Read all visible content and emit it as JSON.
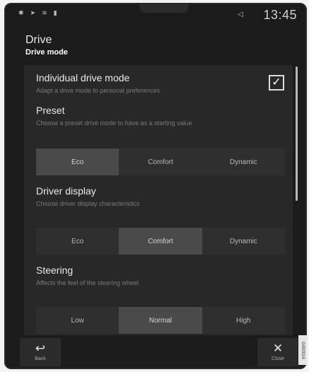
{
  "status": {
    "time": "13:45",
    "icons": [
      "bluetooth-icon",
      "navigation-icon",
      "wifi-icon",
      "signal-icon"
    ],
    "volume_icon": "volume-icon"
  },
  "header": {
    "title": "Drive",
    "subtitle": "Drive mode"
  },
  "settings": {
    "individual": {
      "label": "Individual drive mode",
      "desc": "Adapt a drive mode to personal preferences",
      "checked": true
    },
    "preset": {
      "label": "Preset",
      "desc": "Choose a preset drive mode to have as a starting value",
      "options": [
        "Eco",
        "Comfort",
        "Dynamic"
      ],
      "selected": "Eco"
    },
    "driver_display": {
      "label": "Driver display",
      "desc": "Choose driver display characteristics",
      "options": [
        "Eco",
        "Comfort",
        "Dynamic"
      ],
      "selected": "Comfort"
    },
    "steering": {
      "label": "Steering",
      "desc": "Affects the feel of the steering wheel",
      "options": [
        "Low",
        "Normal",
        "High"
      ],
      "selected": "Normal"
    }
  },
  "footer": {
    "back_label": "Back",
    "close_label": "Close",
    "code": "G000016"
  },
  "colors": {
    "background": "#1b1b1b",
    "panel": "#282828",
    "selected_segment": "#4a4a4a",
    "text": "#eaeaea",
    "muted_text": "#7a7a7a"
  }
}
